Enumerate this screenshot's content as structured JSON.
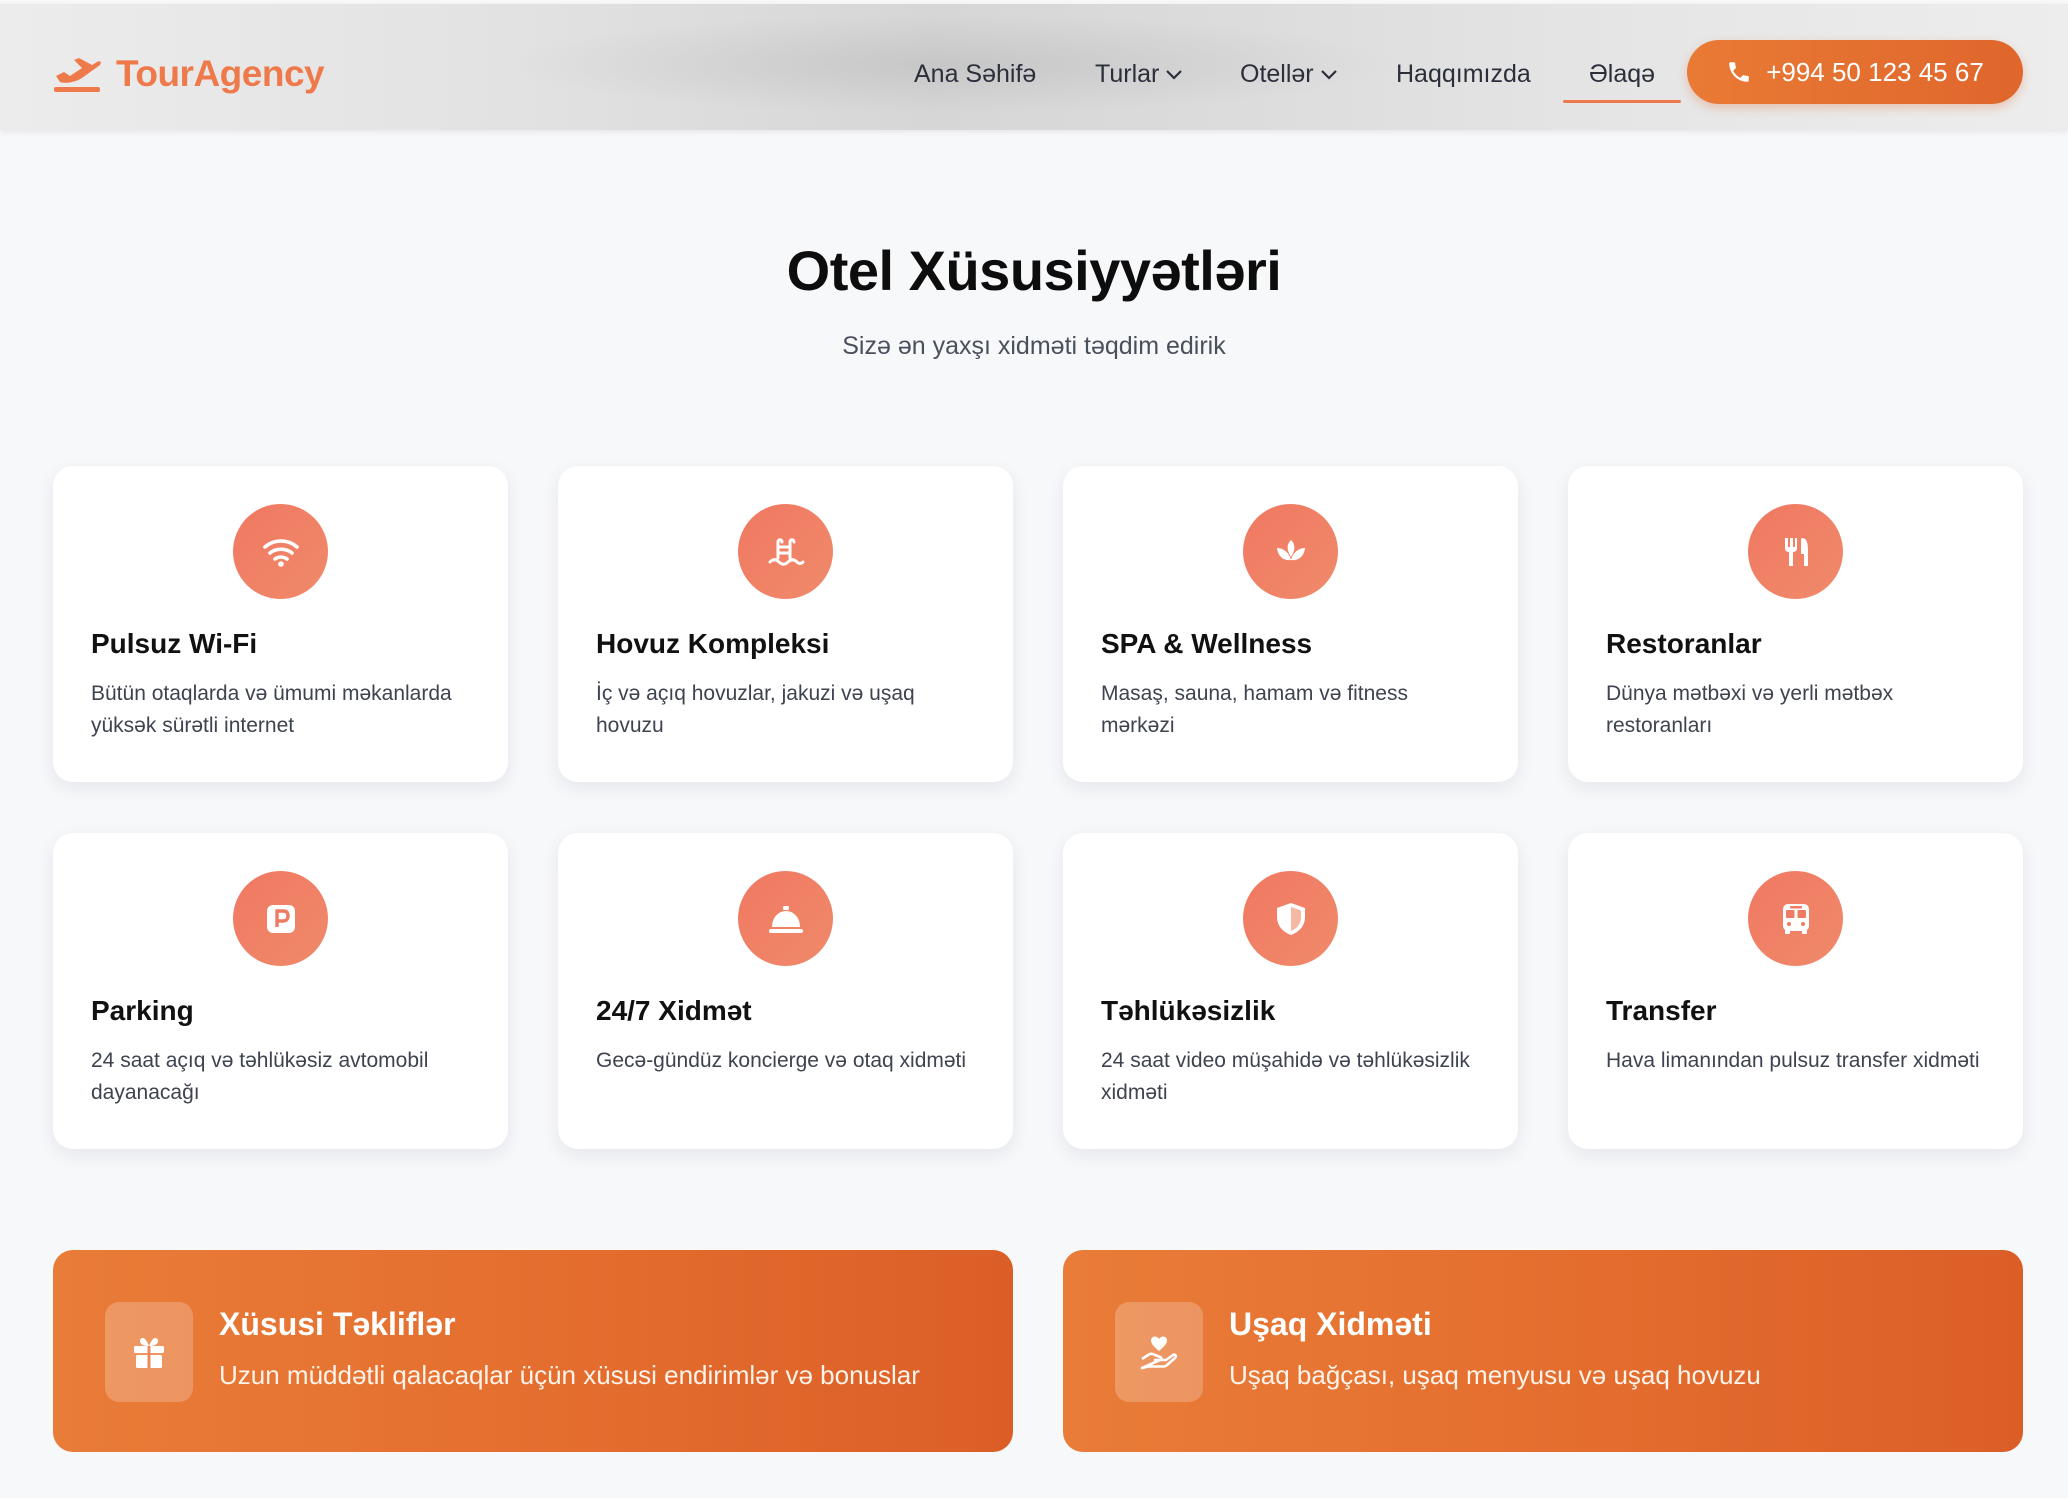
{
  "brand": {
    "name": "TourAgency",
    "accent": "#ee7a4c",
    "icon": "plane-icon"
  },
  "nav": {
    "home": "Ana Səhifə",
    "tours": "Turlar",
    "hotels": "Otellər",
    "about": "Haqqımızda",
    "contact": "Əlaqə",
    "active": "contact",
    "phone": "+994 50 123 45 67"
  },
  "section": {
    "title": "Otel Xüsusiyyətləri",
    "subtitle": "Sizə ən yaxşı xidməti təqdim edirik"
  },
  "features": [
    {
      "icon": "wifi-icon",
      "title": "Pulsuz Wi-Fi",
      "desc": "Bütün otaqlarda və ümumi məkanlarda yüksək sürətli internet"
    },
    {
      "icon": "pool-icon",
      "title": "Hovuz Kompleksi",
      "desc": "İç və açıq hovuzlar, jakuzi və uşaq hovuzu"
    },
    {
      "icon": "spa-lotus-icon",
      "title": "SPA & Wellness",
      "desc": "Masaş, sauna, hamam və fitness mərkəzi"
    },
    {
      "icon": "utensils-icon",
      "title": "Restoranlar",
      "desc": "Dünya mətbəxi və yerli mətbəx restoranları"
    },
    {
      "icon": "parking-icon",
      "title": "Parking",
      "desc": "24 saat açıq və təhlükəsiz avtomobil dayanacağı"
    },
    {
      "icon": "concierge-bell-icon",
      "title": "24/7 Xidmət",
      "desc": "Gecə-gündüz koncierge və otaq xidməti"
    },
    {
      "icon": "shield-icon",
      "title": "Təhlükəsizlik",
      "desc": "24 saat video müşahidə və təhlükəsizlik xidməti"
    },
    {
      "icon": "bus-icon",
      "title": "Transfer",
      "desc": "Hava limanından pulsuz transfer xidməti"
    }
  ],
  "promos": [
    {
      "icon": "gift-icon",
      "title": "Xüsusi Təkliflər",
      "desc": "Uzun müddətli qalacaqlar üçün xüsusi endirimlər və bonuslar"
    },
    {
      "icon": "hand-heart-icon",
      "title": "Uşaq Xidməti",
      "desc": "Uşaq bağçası, uşaq menyusu və uşaq hovuzu"
    }
  ]
}
